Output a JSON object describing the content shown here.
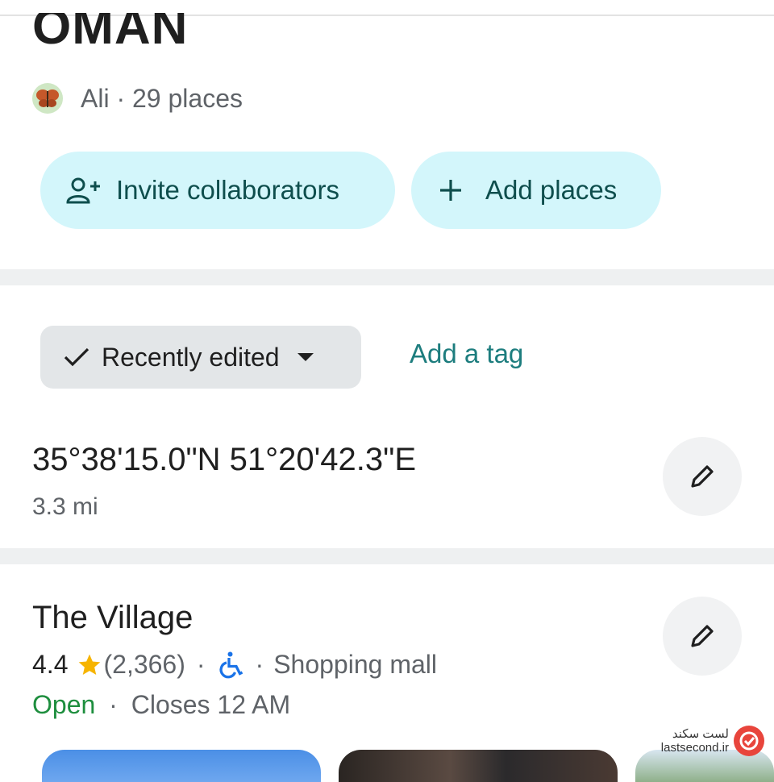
{
  "list": {
    "title": "OMAN",
    "owner": "Ali",
    "separator": "·",
    "place_count": "29 places"
  },
  "actions": {
    "invite_label": "Invite collaborators",
    "add_places_label": "Add places"
  },
  "filters": {
    "sort_label": "Recently edited",
    "add_tag_label": "Add a tag"
  },
  "places": [
    {
      "name": "35°38'15.0\"N 51°20'42.3\"E",
      "distance": "3.3 mi"
    },
    {
      "name": "The Village",
      "rating": "4.4",
      "reviews": "(2,366)",
      "category": "Shopping mall",
      "status": "Open",
      "hours": "Closes 12 AM"
    }
  ],
  "watermark": {
    "text_fa": "لست سکند",
    "text_en": "lastsecond.ir"
  },
  "colors": {
    "button_bg": "#d3f6fb",
    "button_text": "#0e4e4d",
    "link": "#1d7d7e",
    "open_green": "#1e8e3e",
    "star": "#f6b400",
    "accessible_blue": "#1a73e8"
  },
  "icons": [
    "add-person-icon",
    "plus-icon",
    "check-icon",
    "dropdown-arrow-icon",
    "pencil-icon",
    "star-icon",
    "wheelchair-icon"
  ]
}
